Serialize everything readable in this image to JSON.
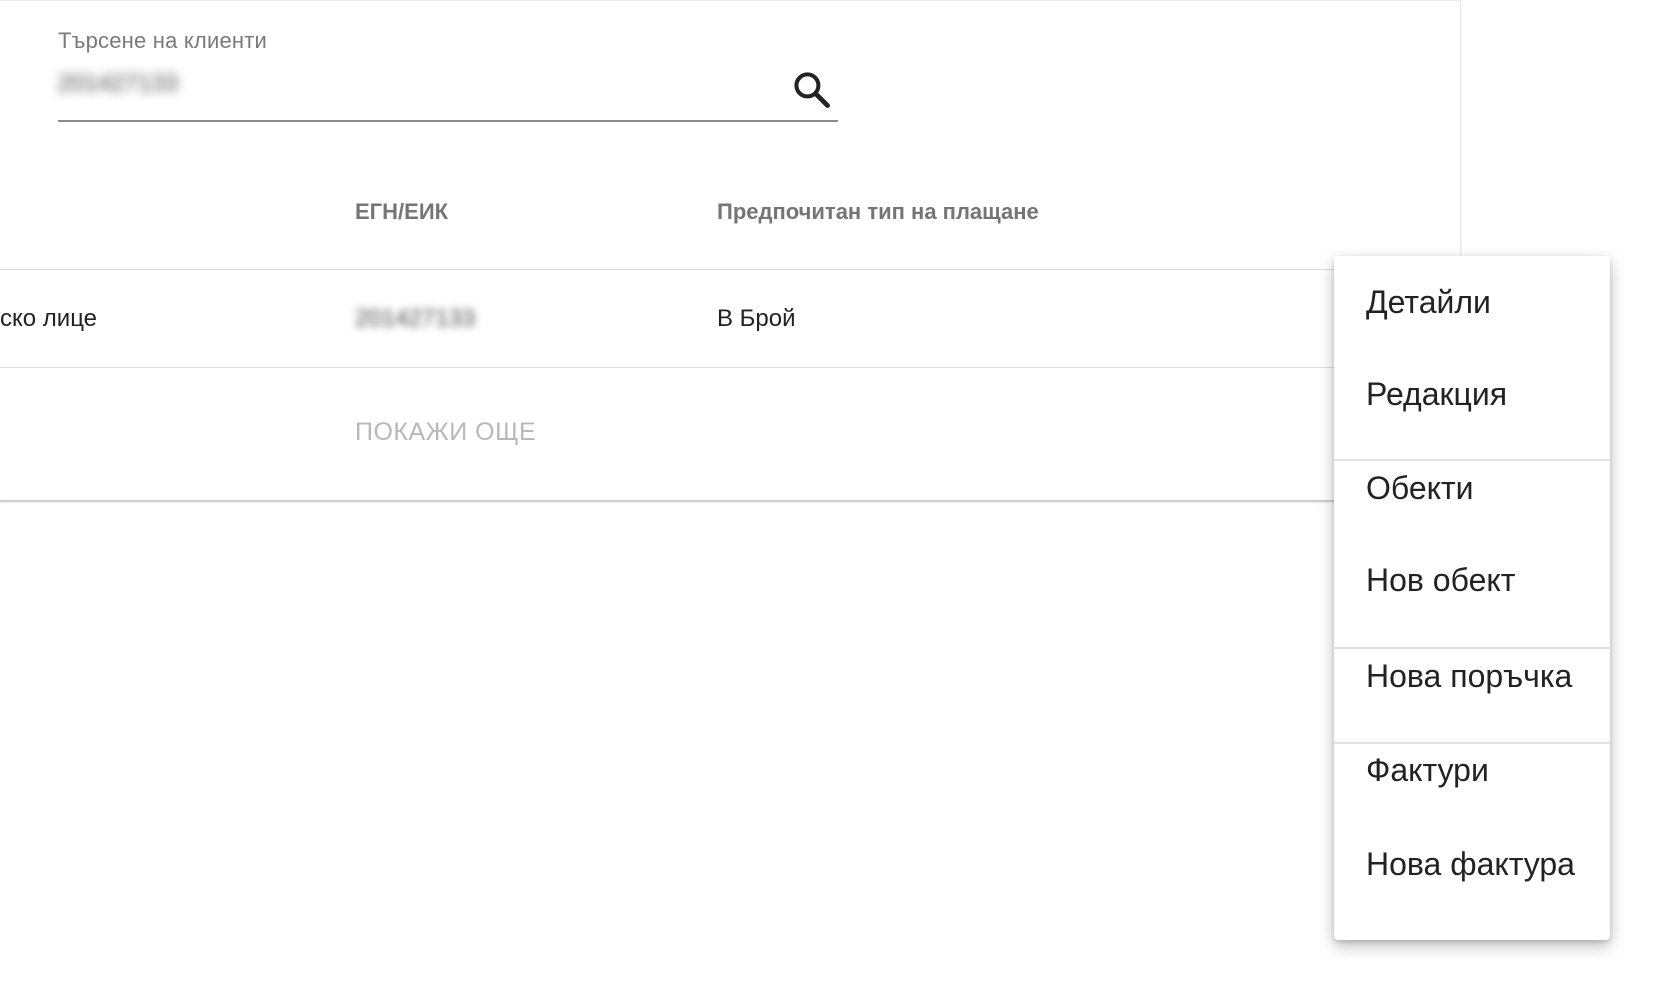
{
  "search": {
    "label": "Търсене на клиенти",
    "value": "201427133"
  },
  "table": {
    "columns": [
      "ЕГН/ЕИК",
      "Предпочитан тип на плащане"
    ],
    "rows": [
      {
        "type": "ско лице",
        "id": "201427133",
        "payment": "В Брой"
      }
    ],
    "show_more_label": "ПОКАЖИ ОЩЕ"
  },
  "menu": {
    "items": [
      "Детайли",
      "Редакция",
      "Обекти",
      "Нов обект",
      "Нова поръчка",
      "Фактури",
      "Нова фактура"
    ]
  },
  "icons": {
    "search": "search-icon"
  }
}
